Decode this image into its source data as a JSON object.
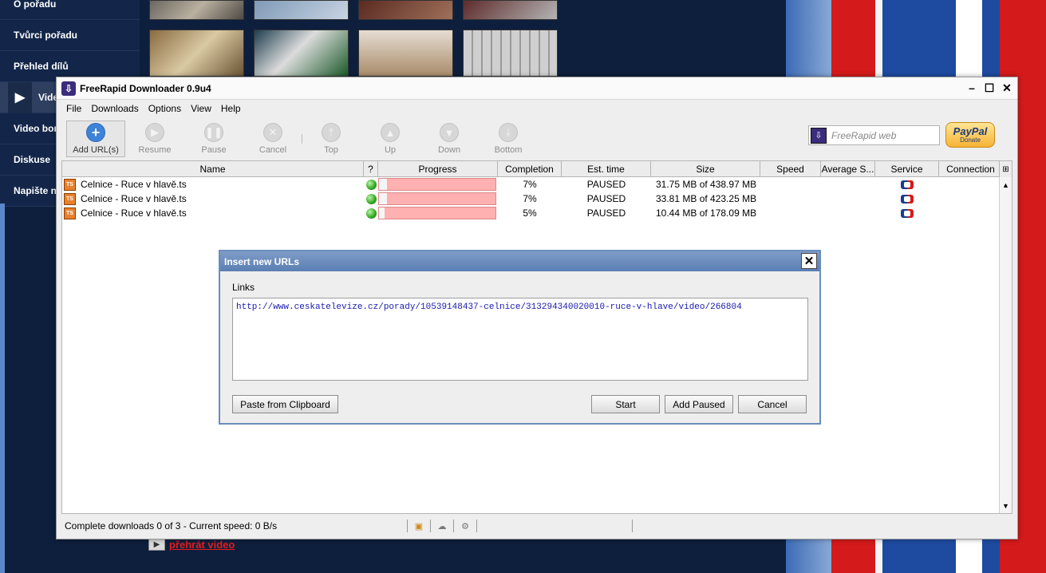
{
  "background": {
    "sidebar_items": [
      "O pořadu",
      "Tvůrci pořadu",
      "Přehled dílů",
      "Vide",
      "Video bon",
      "Diskuse",
      "Napište n"
    ],
    "play_link": "přehrát video"
  },
  "window": {
    "title": "FreeRapid Downloader 0.9u4",
    "controls": [
      "minimize",
      "maximize",
      "close"
    ]
  },
  "menu": [
    "File",
    "Downloads",
    "Options",
    "View",
    "Help"
  ],
  "toolbar": {
    "buttons": [
      {
        "label": "Add URL(s)",
        "icon": "plus-icon",
        "enabled": true
      },
      {
        "label": "Resume",
        "icon": "play-icon",
        "enabled": false
      },
      {
        "label": "Pause",
        "icon": "pause-icon",
        "enabled": false
      },
      {
        "label": "Cancel",
        "icon": "cancel-icon",
        "enabled": false
      },
      {
        "label": "Top",
        "icon": "top-icon",
        "enabled": false
      },
      {
        "label": "Up",
        "icon": "up-icon",
        "enabled": false
      },
      {
        "label": "Down",
        "icon": "down-icon",
        "enabled": false
      },
      {
        "label": "Bottom",
        "icon": "bottom-icon",
        "enabled": false
      }
    ],
    "web_placeholder": "FreeRapid web",
    "paypal": {
      "brand": "PayPal",
      "label": "Donate"
    }
  },
  "table": {
    "columns": [
      "Name",
      "?",
      "Progress",
      "Completion",
      "Est. time",
      "Size",
      "Speed",
      "Average S...",
      "Service",
      "Connection"
    ],
    "rows": [
      {
        "name": "Celnice - Ruce v hlavě.ts",
        "progress": 0.07,
        "completion": "7%",
        "est_time": "PAUSED",
        "size": "31.75 MB of 438.97 MB",
        "speed": "",
        "avg_speed": "",
        "connection": ""
      },
      {
        "name": "Celnice - Ruce v hlavě.ts",
        "progress": 0.07,
        "completion": "7%",
        "est_time": "PAUSED",
        "size": "33.81 MB of 423.25 MB",
        "speed": "",
        "avg_speed": "",
        "connection": ""
      },
      {
        "name": "Celnice - Ruce v hlavě.ts",
        "progress": 0.05,
        "completion": "5%",
        "est_time": "PAUSED",
        "size": "10.44 MB of 178.09 MB",
        "speed": "",
        "avg_speed": "",
        "connection": ""
      }
    ]
  },
  "status": {
    "text": "Complete downloads 0 of 3 - Current speed: 0 B/s"
  },
  "dialog": {
    "title": "Insert new URLs",
    "links_label": "Links",
    "url_text": "http://www.ceskatelevize.cz/porady/10539148437-celnice/313294340020010-ruce-v-hlave/video/266804",
    "buttons": {
      "paste": "Paste from Clipboard",
      "start": "Start",
      "add_paused": "Add Paused",
      "cancel": "Cancel"
    }
  },
  "colors": {
    "progress_bar": "#ffb0b0",
    "dialog_title": "#6a8dbd",
    "url_text": "#1a1ab0"
  }
}
